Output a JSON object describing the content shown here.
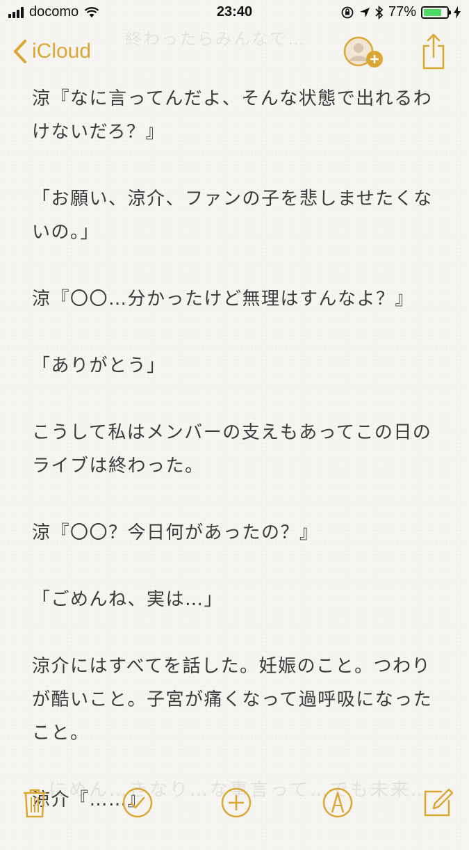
{
  "status_bar": {
    "carrier": "docomo",
    "time": "23:40",
    "battery": "77%",
    "battery_level": 0.77
  },
  "nav": {
    "back_label": "iCloud",
    "bg_text": "終わったらみんなで…"
  },
  "note": {
    "paragraphs": [
      "涼『なに言ってんだよ、そんな状態で出れるわけないだろ？』",
      "「お願い、涼介、ファンの子を悲しませたくないの。」",
      "涼『〇〇…分かったけど無理はすんなよ？』",
      "「ありがとう」",
      "こうして私はメンバーの支えもあってこの日のライブは終わった。",
      "涼『〇〇？今日何があったの？』",
      "「ごめんね、実は…」",
      "涼介にはすべてを話した。妊娠のこと。つわりが酷いこと。子宮が痛くなって過呼吸になったこと。",
      "涼介『……』"
    ]
  },
  "toolbar": {
    "bg_text": "にめん…きなり…な事言って…でも未来…",
    "icons": [
      "trash-icon",
      "checklist-icon",
      "add-icon",
      "sketch-icon",
      "compose-icon"
    ]
  },
  "colors": {
    "accent": "#dba733",
    "text": "#3b3b3b",
    "battery": "#4cd964"
  }
}
